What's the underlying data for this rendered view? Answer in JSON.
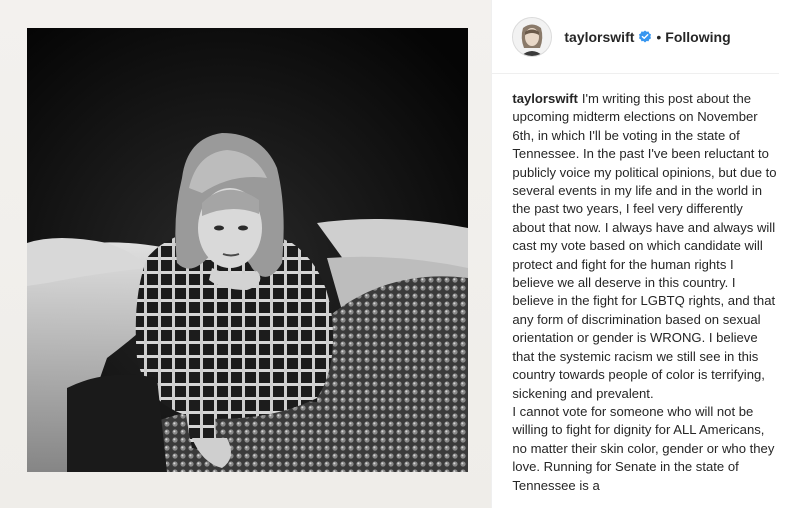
{
  "post": {
    "username": "taylorswift",
    "follow_separator": "•",
    "follow_status": "Following",
    "caption_text": "I'm writing this post about the upcoming midterm elections on November 6th, in which I'll be voting in the state of Tennessee. In the past I've been reluctant to publicly voice my political opinions, but due to several events in my life and in the world in the past two years, I feel very differently about that now. I always have and always will cast my vote based on which candidate will protect and fight for the human rights I believe we all deserve in this country. I believe in the fight for LGBTQ rights, and that any form of discrimination based on sexual orientation or gender is WRONG. I believe that the systemic racism we still see in this country towards people of color is terrifying, sickening and prevalent.\nI cannot vote for someone who will not be willing to fight for dignity for ALL Americans, no matter their skin color, gender or who they love. Running for Senate in the state of Tennessee is a"
  },
  "icons": {
    "verified": "verified-badge-icon"
  },
  "colors": {
    "verified_blue": "#3897f0",
    "text": "#262626",
    "divider": "#efefef"
  }
}
